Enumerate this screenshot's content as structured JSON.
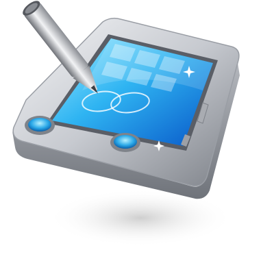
{
  "icon": {
    "subject": "tablet-with-stylus",
    "colors": {
      "body": "#c9ccd2",
      "body_dark": "#8c9097",
      "screen_light": "#7fe0ff",
      "screen_dark": "#0a6fd6",
      "button": "#2aa8e8",
      "pen": "#b9bcc2",
      "pen_tip": "#4a4d52",
      "shadow": "#d8d8d8"
    }
  }
}
